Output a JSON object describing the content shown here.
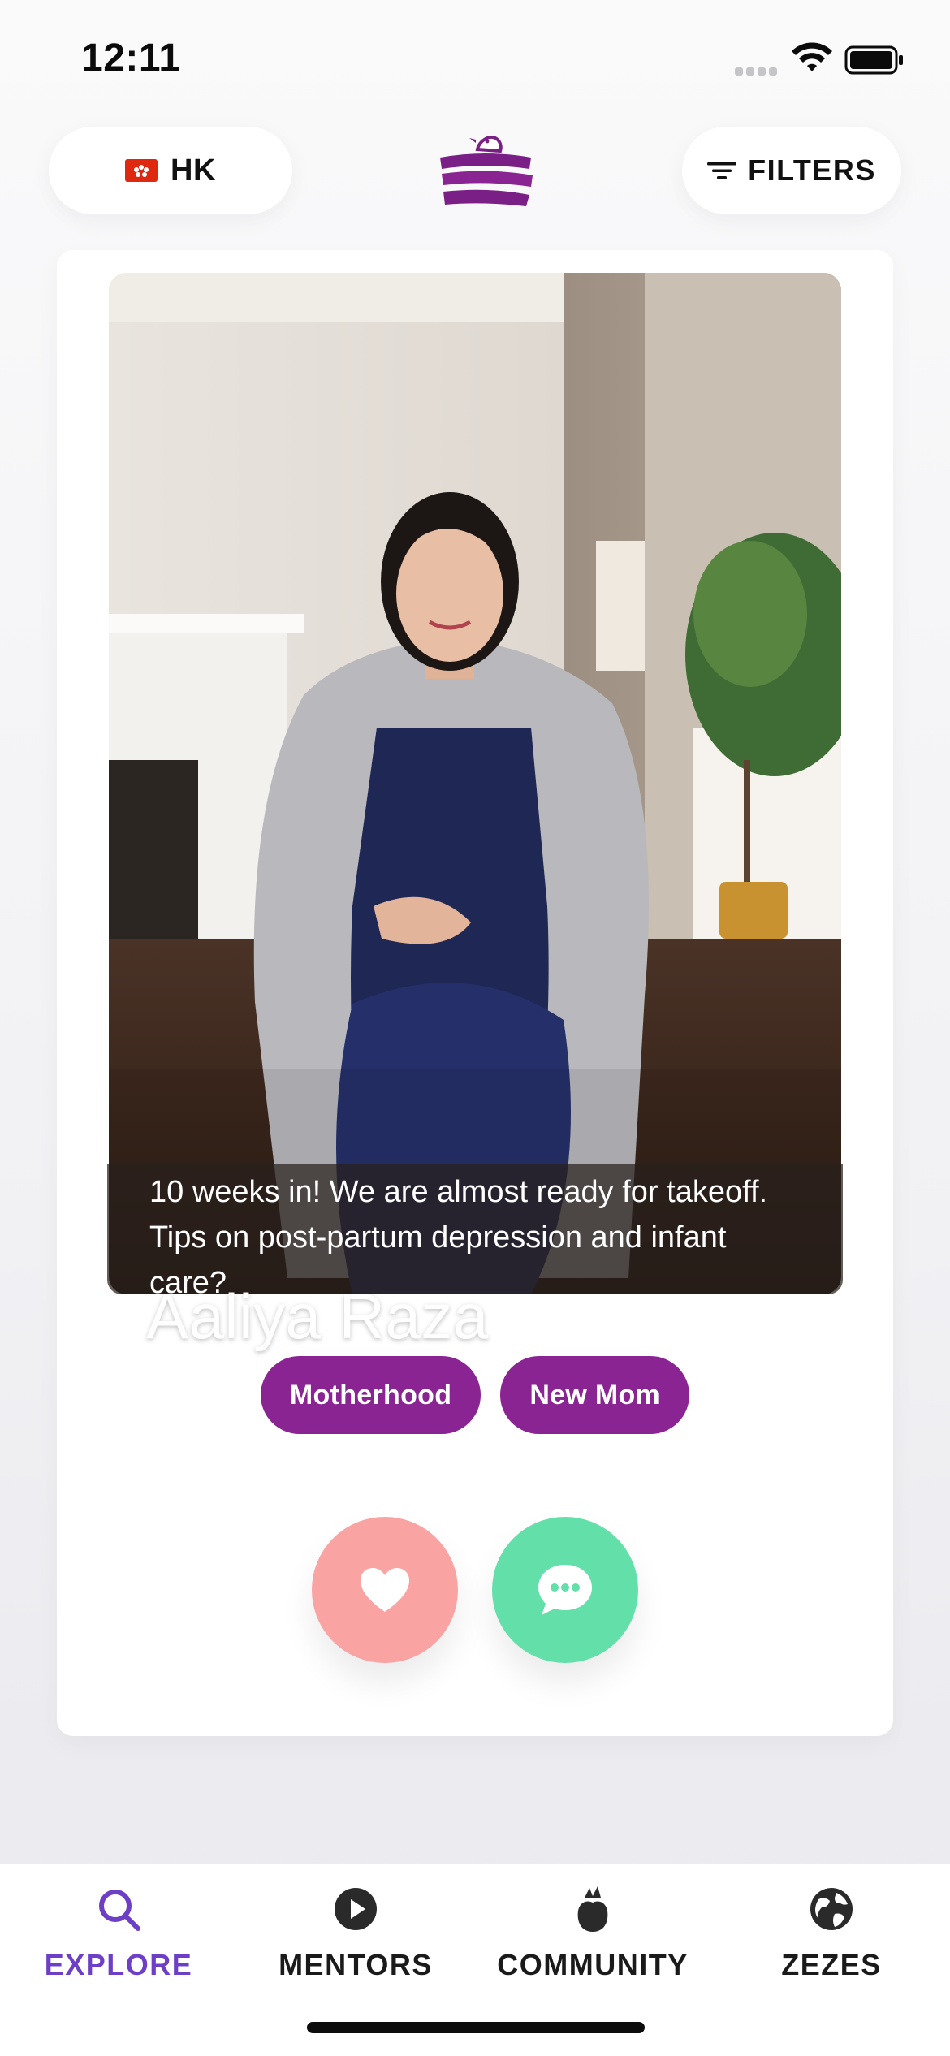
{
  "status_bar": {
    "time": "12:11"
  },
  "header": {
    "region_label": "HK",
    "filters_label": "FILTERS"
  },
  "profile": {
    "name": "Aaliya Raza",
    "caption": "10 weeks in! We are almost ready for takeoff. Tips on post-partum depression and infant care?",
    "tags": [
      "Motherhood",
      "New Mom"
    ]
  },
  "actions": {
    "like_icon": "heart-icon",
    "chat_icon": "chat-bubble-icon"
  },
  "nav": {
    "items": [
      {
        "label": "EXPLORE",
        "icon": "search-icon",
        "active": true
      },
      {
        "label": "MENTORS",
        "icon": "play-icon",
        "active": false
      },
      {
        "label": "COMMUNITY",
        "icon": "flower-icon",
        "active": false
      },
      {
        "label": "ZEZES",
        "icon": "globe-icon",
        "active": false
      }
    ]
  },
  "colors": {
    "accent": "#8a2493",
    "active_nav": "#6c3fc6",
    "like": "#f9a3a3",
    "chat": "#63dfa9"
  }
}
